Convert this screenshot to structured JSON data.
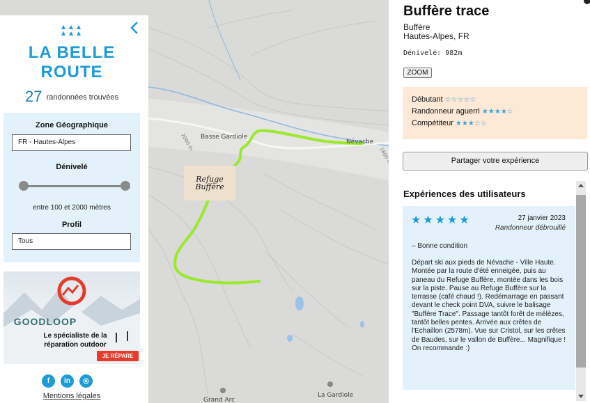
{
  "sidebar": {
    "brand_line1": "LA BELLE",
    "brand_line2": "ROUTE",
    "result_count": "27",
    "result_label": "randonnées trouvées",
    "zone_title": "Zone Géographique",
    "zone_value": "FR - Hautes-Alpes",
    "elevation_title": "Dénivelé",
    "elevation_range": "entre 100 et 2000 mètres",
    "profile_title": "Profil",
    "profile_value": "Tous",
    "ad_brand": "GOODLOOP",
    "ad_tagline": "Le spécialiste de la réparation outdoor",
    "ad_button": "JE RÉPARE",
    "legal_link": "Mentions légales",
    "colors": {
      "brand": "#1e9bd7",
      "filter_bg": "#e3f1fa"
    }
  },
  "map": {
    "labels": {
      "basse_gardiole": "Basse Gardiole",
      "nevache": "Névache",
      "la_gardiole": "La Gardiole",
      "grand_arc": "Grand Arc",
      "elev_2000": "2000 m",
      "elev_1800": "1800 m"
    },
    "refuge_label_1": "Refuge",
    "refuge_label_2": "Buffère",
    "route_color": "#9be82c"
  },
  "panel": {
    "title": "Buffère trace",
    "location_name": "Buffère",
    "region": "Hautes-Alpes, FR",
    "elevation": "Dénivelé: 982m",
    "zoom_button": "ZOOM",
    "levels": [
      {
        "label": "Débutant",
        "stars": "☆☆☆☆☆"
      },
      {
        "label": "Randonneur aguerri",
        "stars": "★★★★☆"
      },
      {
        "label": "Compétiteur",
        "stars": "★★★☆☆"
      }
    ],
    "share_button": "Partager votre expérience",
    "experiences_title": "Expériences des utilisateurs",
    "experience": {
      "stars": "★★★★★",
      "date": "27 janvier 2023",
      "level": "Randonneur débrouillé",
      "condition": "– Bonne condition",
      "text": "Départ ski aux pieds de Névache - Ville Haute. Montée par la route d'été enneigée, puis au paneau du Refuge Buffère, montée dans les bois sur la piste. Pause au Refuge Buffère sur la terrasse (café chaud !). Redémarrage en passant devant le check point DVA, suivre le balisage \"Buffère Trace\". Passage tantôt forêt de mélèzes, tantôt belles pentes. Arrivée aux crêtes de l'Echaillon (2578m). Vue sur Cristol, sur les crêtes de Baudes, sur le vallon de Buffère... Magnifique ! On recommande :)"
    },
    "colors": {
      "levels_bg": "#fde9d5",
      "star": "#37a5dd"
    }
  }
}
